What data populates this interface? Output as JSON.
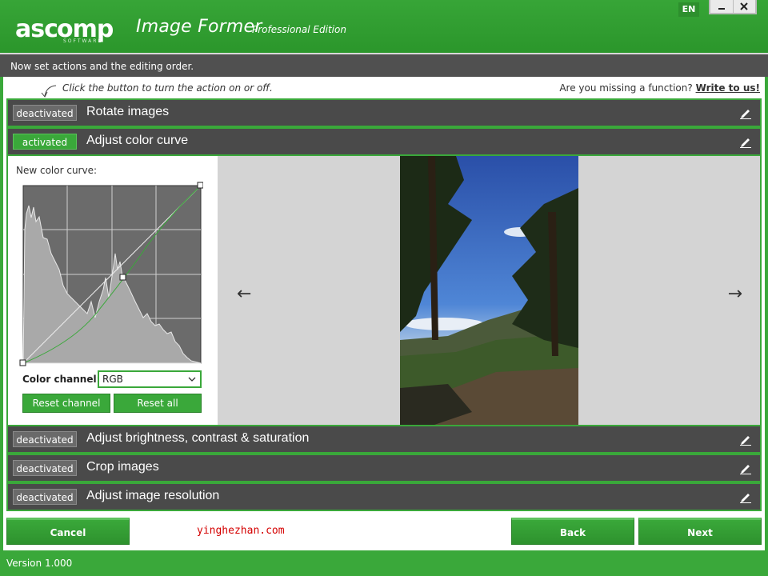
{
  "header": {
    "logo_text": "ASCOMP SOFTWARE",
    "title": "Image Former",
    "edition": "Professional Edition",
    "language": "EN",
    "minimize_icon": "minimize-icon",
    "close_icon": "close-icon"
  },
  "step_text": "Now set actions and the editing order.",
  "hint": "Click the button to turn the action on or off.",
  "missing": {
    "text": "Are you missing a function?",
    "link": "Write to us!"
  },
  "actions": [
    {
      "state": "deactivated",
      "label": "Rotate images"
    },
    {
      "state": "activated",
      "label": "Adjust color curve"
    },
    {
      "state": "deactivated",
      "label": "Adjust brightness, contrast & saturation"
    },
    {
      "state": "deactivated",
      "label": "Crop images"
    },
    {
      "state": "deactivated",
      "label": "Adjust image resolution"
    }
  ],
  "curve_panel": {
    "caption": "New color curve:",
    "channel_label": "Color channel:",
    "channel_value": "RGB",
    "reset_channel": "Reset channel",
    "reset_all": "Reset all"
  },
  "preview": {
    "prev_arrow": "←",
    "next_arrow": "→"
  },
  "buttons": {
    "cancel": "Cancel",
    "back": "Back",
    "next": "Next"
  },
  "watermark": "yinghezhan.com",
  "status": "Version 1.000",
  "colors": {
    "brand_green": "#3aa83a",
    "row_gray": "#4a4a4a",
    "accent_red": "#d40000"
  }
}
